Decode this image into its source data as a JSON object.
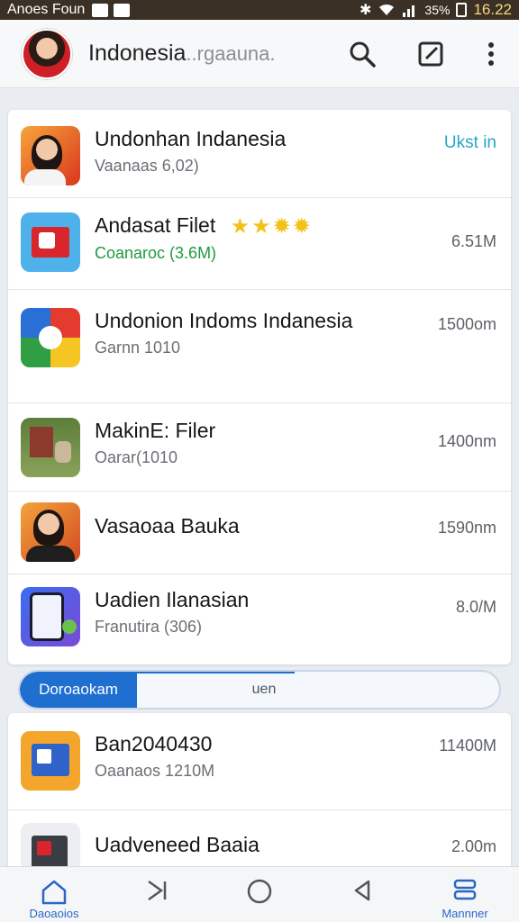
{
  "status_bar": {
    "carrier": "Anoes Foun",
    "battery": "35%",
    "time": "16.22"
  },
  "header": {
    "title": "Indonesia",
    "subtitle": "..rgaauna."
  },
  "apps": [
    {
      "name": "Undonhan Indanesia",
      "sub": "Vaanaas 6,02)",
      "meta": "Ukst in",
      "meta_type": "action",
      "icon": "portrait-icon"
    },
    {
      "name": "Andasat Filet",
      "sub": "Coanaroc (3.6M)",
      "sub_color": "green",
      "meta": "6.51M",
      "rating": 3,
      "icon": "file-box-icon"
    },
    {
      "name": "Undonion Indoms Indanesia",
      "sub": "Garnn 1010",
      "meta": "1500om",
      "icon": "game-icon"
    },
    {
      "name": "MakinE: Filer",
      "sub": "Oarar(1010",
      "meta": "1400nm",
      "icon": "photo-icon"
    },
    {
      "name": "Vasaoaa Bauka",
      "sub": "",
      "meta": "1590nm",
      "icon": "portrait-icon"
    },
    {
      "name": "Uadien Ilanasian",
      "sub": "Franutira (306)",
      "meta": "8.0/M",
      "icon": "phone-app-icon"
    }
  ],
  "tabs": {
    "active": "Doroaokam",
    "inactive": "uen"
  },
  "lower_apps": [
    {
      "name": "Ban2040430",
      "sub": "Oaanaos 1210M",
      "meta": "11400M",
      "icon": "box-icon"
    },
    {
      "name": "Uadveneed Baaia",
      "sub": "",
      "meta": "2.00m",
      "icon": "box-icon-dark"
    }
  ],
  "nav": {
    "home_label": "Daoaoios",
    "menu_label": "Mannner"
  },
  "colors": {
    "accent": "#1f6fd1",
    "action": "#27a6c8",
    "green": "#1f9a3d"
  }
}
